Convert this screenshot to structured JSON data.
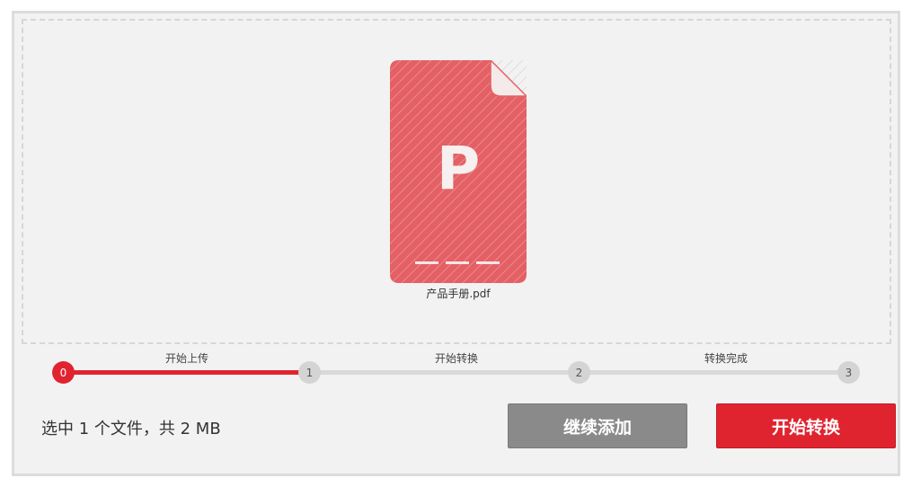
{
  "file": {
    "name": "产品手册.pdf",
    "icon_letter": "P",
    "icon": "pdf-file-icon",
    "color": "#e46064"
  },
  "steps": [
    {
      "number": "0",
      "label": "开始上传"
    },
    {
      "number": "1",
      "label": "开始转换"
    },
    {
      "number": "2",
      "label": "转换完成"
    },
    {
      "number": "3"
    }
  ],
  "summary": "选中 1 个文件，共 2 MB",
  "buttons": {
    "add": "继续添加",
    "start": "开始转换"
  },
  "colors": {
    "accent": "#e0242f",
    "neutral_button": "#8a8a8a",
    "track": "#d9d9d9"
  }
}
